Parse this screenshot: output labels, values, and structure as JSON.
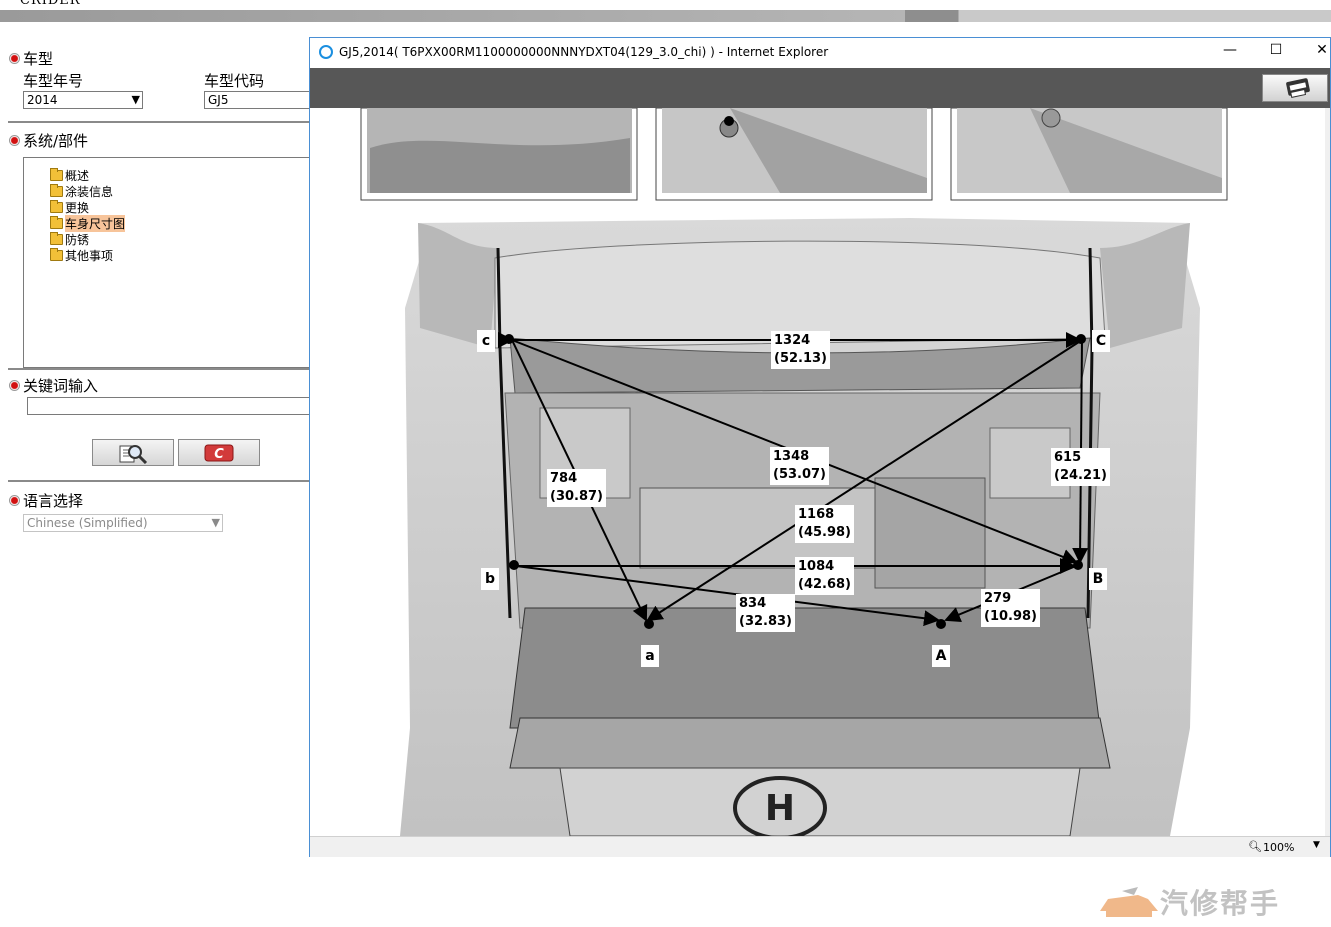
{
  "top": {
    "brand": "CRIDER"
  },
  "left": {
    "vehicle": {
      "header": "车型",
      "year_label": "车型年号",
      "year_value": "2014",
      "code_label": "车型代码",
      "code_value": "GJ5"
    },
    "system": {
      "header": "系统/部件",
      "items": [
        "概述",
        "涂装信息",
        "更换",
        "车身尺寸图",
        "防锈",
        "其他事项"
      ]
    },
    "keyword": {
      "header": "关键词输入",
      "value": ""
    },
    "language": {
      "header": "语言选择",
      "value": "Chinese (Simplified)"
    }
  },
  "window": {
    "title": "GJ5,2014( T6PXX00RM1100000000NNNYDXT04(129_3.0_chi) ) - Internet Explorer",
    "controls": {
      "minimize": "—",
      "maximize": "☐",
      "close": "✕"
    },
    "zoom": "100%"
  },
  "diagram": {
    "points": {
      "c": "c",
      "C": "C",
      "b": "b",
      "B": "B",
      "a": "a",
      "A": "A"
    },
    "dims": [
      {
        "main": "1324",
        "sub": "(52.13)"
      },
      {
        "main": "1348",
        "sub": "(53.07)"
      },
      {
        "main": "784",
        "sub": "(30.87)"
      },
      {
        "main": "615",
        "sub": "(24.21)"
      },
      {
        "main": "1168",
        "sub": "(45.98)"
      },
      {
        "main": "1084",
        "sub": "(42.68)"
      },
      {
        "main": "834",
        "sub": "(32.83)"
      },
      {
        "main": "279",
        "sub": "(10.98)"
      }
    ]
  },
  "watermark": {
    "text": "汽修帮手"
  }
}
